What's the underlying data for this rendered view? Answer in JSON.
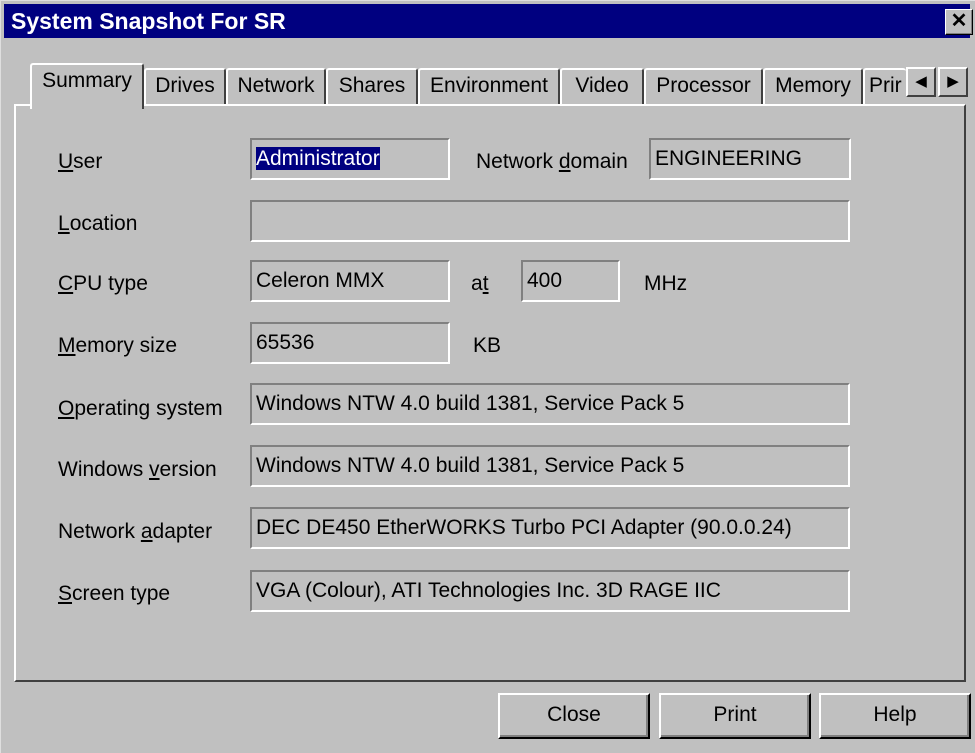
{
  "window": {
    "title": "System Snapshot For SR",
    "close_glyph": "✕"
  },
  "tabs": [
    {
      "label": "Summary",
      "active": true
    },
    {
      "label": "Drives"
    },
    {
      "label": "Network"
    },
    {
      "label": "Shares"
    },
    {
      "label": "Environment"
    },
    {
      "label": "Video"
    },
    {
      "label": "Processor"
    },
    {
      "label": "Memory"
    },
    {
      "label": "Prir"
    }
  ],
  "tab_scroll": {
    "left_icon": "◀",
    "right_icon": "▶"
  },
  "summary": {
    "user": {
      "label_u": "U",
      "label_rest": "ser",
      "value": "Administrator"
    },
    "network_domain": {
      "label_pre": "Network ",
      "label_u": "d",
      "label_rest": "omain",
      "value": "ENGINEERING"
    },
    "location": {
      "label_u": "L",
      "label_rest": "ocation",
      "value": ""
    },
    "cpu_type": {
      "label_u": "C",
      "label_rest": "PU type",
      "value": "Celeron MMX"
    },
    "cpu_at": {
      "label_pre": "a",
      "label_u": "t",
      "value": "400",
      "unit": "MHz"
    },
    "memory_size": {
      "label_u": "M",
      "label_rest": "emory size",
      "value": "65536",
      "unit": "KB"
    },
    "operating_system": {
      "label_u": "O",
      "label_rest": "perating system",
      "value": "Windows NTW 4.0 build 1381, Service Pack 5"
    },
    "windows_version": {
      "label_pre": "Windows ",
      "label_u": "v",
      "label_rest": "ersion",
      "value": "Windows NTW 4.0 build 1381, Service Pack 5"
    },
    "network_adapter": {
      "label_pre": "Network ",
      "label_u": "a",
      "label_rest": "dapter",
      "value": "DEC DE450 EtherWORKS Turbo PCI Adapter (90.0.0.24)"
    },
    "screen_type": {
      "label_u": "S",
      "label_rest": "creen type",
      "value": "VGA (Colour), ATI Technologies Inc. 3D RAGE IIC"
    }
  },
  "buttons": {
    "close": "Close",
    "print": "Print",
    "help": "Help"
  }
}
